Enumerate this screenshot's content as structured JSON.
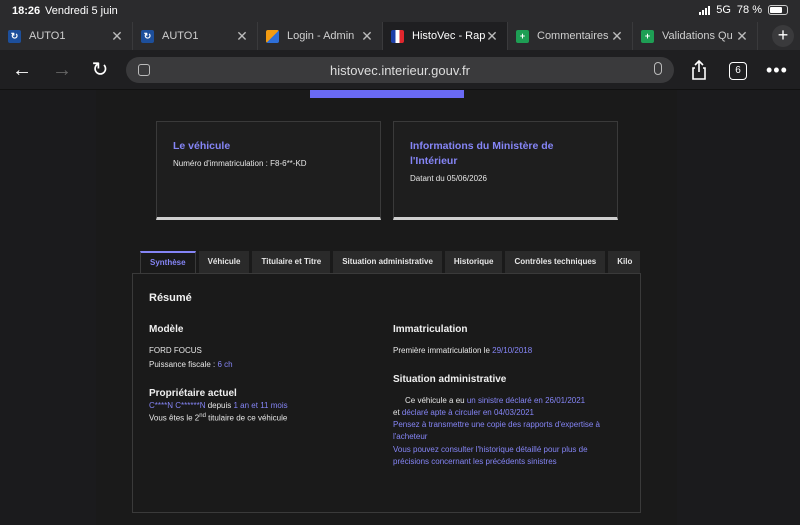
{
  "status": {
    "time": "18:26",
    "date": "Vendredi 5 juin",
    "network": "5G",
    "battery": "78 %",
    "battery_level": 0.78
  },
  "tabs": [
    {
      "label": "AUTO1",
      "favicon": "auto1-icon"
    },
    {
      "label": "AUTO1",
      "favicon": "auto1-icon"
    },
    {
      "label": "Login - Admin",
      "favicon": "login-icon"
    },
    {
      "label": "HistoVec - Rap",
      "favicon": "histovec-icon"
    },
    {
      "label": "Commentaires",
      "favicon": "sheet-icon"
    },
    {
      "label": "Validations Qu",
      "favicon": "sheet-icon"
    }
  ],
  "toolbar": {
    "url": "histovec.interieur.gouv.fr",
    "tab_count": "6"
  },
  "cards": {
    "vehicle": {
      "title": "Le véhicule",
      "line": "Numéro d'immatriculation : F8-6**-KD"
    },
    "ministry": {
      "title": "Informations du Ministère de l'Intérieur",
      "line": "Datant du 05/06/2026"
    }
  },
  "page_tabs": [
    "Synthèse",
    "Véhicule",
    "Titulaire et Titre",
    "Situation administrative",
    "Historique",
    "Contrôles techniques",
    "Kilo"
  ],
  "summary": {
    "title": "Résumé",
    "model_heading": "Modèle",
    "model_value": "FORD FOCUS",
    "power_label": "Puissance fiscale : ",
    "power_value": "6 ch",
    "owner_heading": "Propriétaire actuel",
    "owner_name": "C****N C******N",
    "owner_since_label": " depuis ",
    "owner_since_value": "1 an et 11 mois",
    "owner_rank_prefix": "Vous êtes le 2",
    "owner_rank_sup": "nd",
    "owner_rank_suffix": " titulaire de ce véhicule",
    "registration_heading": "Immatriculation",
    "first_registration_label": "Première immatriculation le ",
    "first_registration_value": "29/10/2018",
    "admin_heading": "Situation administrative",
    "admin_line1_prefix": "Ce véhicule a eu ",
    "admin_line1_link": "un sinistre déclaré en 26/01/2021",
    "admin_line2_prefix": "et ",
    "admin_line2_link": "déclaré apte à circuler en 04/03/2021",
    "admin_notice1_a": "Pensez à transmettre une copie des rapports d'expertise à",
    "admin_notice1_b": "l'acheteur",
    "admin_notice2_a": "Vous pouvez consulter l'historique détaillé pour plus de",
    "admin_notice2_b": "précisions concernant les précédents sinistres"
  }
}
